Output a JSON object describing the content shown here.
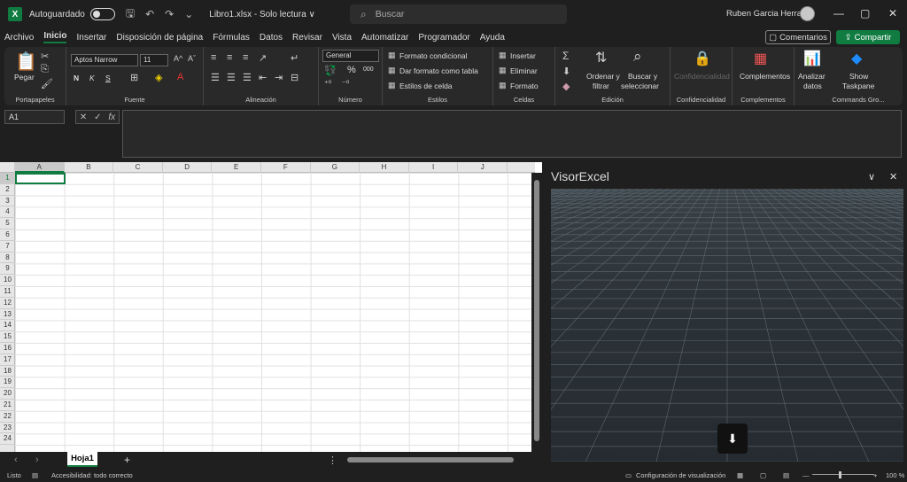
{
  "titlebar": {
    "app_icon": "X",
    "autosave_label": "Autoguardado",
    "filename": "Libro1.xlsx  -  Solo lectura ∨",
    "search_placeholder": "Buscar",
    "user_name": "Ruben Garcia Herranz",
    "minimize": "—",
    "maximize": "▢",
    "close": "✕"
  },
  "menu": [
    "Archivo",
    "Inicio",
    "Insertar",
    "Disposición de página",
    "Fórmulas",
    "Datos",
    "Revisar",
    "Vista",
    "Automatizar",
    "Programador",
    "Ayuda"
  ],
  "menu_active": "Inicio",
  "comments_label": "Comentarios",
  "share_label": "Compartir",
  "ribbon": {
    "portapapeles": {
      "paste": "Pegar",
      "label": "Portapapeles"
    },
    "fuente": {
      "font": "Aptos Narrow",
      "size": "11",
      "label": "Fuente",
      "bold": "N",
      "italic": "K",
      "underline": "S"
    },
    "alineacion": {
      "label": "Alineación"
    },
    "numero": {
      "format": "General",
      "label": "Número",
      "percent": "%",
      "thousands": "000"
    },
    "estilos": {
      "cond": "Formato condicional",
      "table": "Dar formato como tabla",
      "cell": "Estilos de celda",
      "label": "Estilos"
    },
    "celdas": {
      "insert": "Insertar",
      "delete": "Eliminar",
      "format": "Formato",
      "label": "Celdas"
    },
    "edicion": {
      "sort1": "Ordenar y",
      "sort2": "filtrar",
      "find1": "Buscar y",
      "find2": "seleccionar",
      "label": "Edición"
    },
    "confidencialidad": {
      "btn": "Confidencialidad",
      "label": "Confidencialidad"
    },
    "complementos": {
      "btn": "Complementos",
      "label": "Complementos"
    },
    "analizar": {
      "l1": "Analizar",
      "l2": "datos"
    },
    "commands": {
      "l1": "Show",
      "l2": "Taskpane",
      "label": "Commands Gro..."
    }
  },
  "namebox": "A1",
  "fx": "fx",
  "columns": [
    "A",
    "B",
    "C",
    "D",
    "E",
    "F",
    "G",
    "H",
    "I",
    "J"
  ],
  "rows": [
    "1",
    "2",
    "3",
    "4",
    "5",
    "6",
    "7",
    "8",
    "9",
    "10",
    "11",
    "12",
    "13",
    "14",
    "15",
    "16",
    "17",
    "18",
    "19",
    "20",
    "21",
    "22",
    "23",
    "24"
  ],
  "sheet_tab": "Hoja1",
  "add_sheet": "+",
  "taskpane": {
    "title": "VisorExcel"
  },
  "status": {
    "ready": "Listo",
    "accessibility": "Accesibilidad: todo correcto",
    "display_settings": "Configuración de visualización",
    "zoom": "100 %"
  }
}
